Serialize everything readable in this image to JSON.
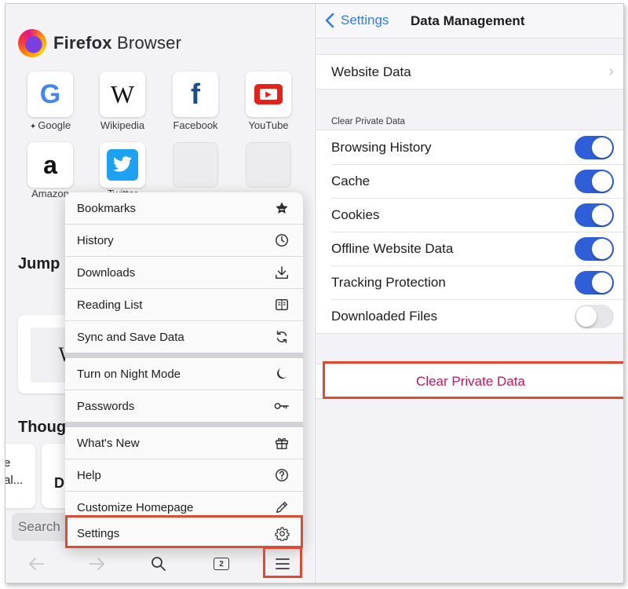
{
  "home": {
    "brand_bold": "Firefox",
    "brand_rest": " Browser",
    "top_sites": [
      {
        "label": "Google",
        "pinned": true,
        "glyph": "G",
        "color": "#4285F4"
      },
      {
        "label": "Wikipedia",
        "pinned": false,
        "glyph": "W",
        "color": "#111111"
      },
      {
        "label": "Facebook",
        "pinned": false,
        "glyph": "f",
        "color": "#1877F2"
      },
      {
        "label": "YouTube",
        "pinned": false,
        "glyph": "▶",
        "color": "#FF0000"
      },
      {
        "label": "Amazon",
        "pinned": false,
        "glyph": "a",
        "color": "#111111"
      },
      {
        "label": "Twitter",
        "pinned": false,
        "glyph": "🐦",
        "color": "#1DA1F2"
      }
    ],
    "jump_heading": "Jump",
    "thought_heading": "Thoug",
    "card_w": "W",
    "card_text_1": "e",
    "card_text_2": "al...",
    "card_d": "D",
    "search_placeholder": "Search",
    "tab_count": "2"
  },
  "menu": {
    "items": [
      {
        "label": "Bookmarks",
        "icon": "star-icon"
      },
      {
        "label": "History",
        "icon": "clock-icon"
      },
      {
        "label": "Downloads",
        "icon": "download-icon"
      },
      {
        "label": "Reading List",
        "icon": "reading-list-icon"
      },
      {
        "label": "Sync and Save Data",
        "icon": "sync-icon"
      },
      {
        "label": "Turn on Night Mode",
        "icon": "moon-icon"
      },
      {
        "label": "Passwords",
        "icon": "key-icon"
      },
      {
        "label": "What's New",
        "icon": "gift-icon"
      },
      {
        "label": "Help",
        "icon": "help-icon"
      },
      {
        "label": "Customize Homepage",
        "icon": "pencil-icon"
      },
      {
        "label": "Settings",
        "icon": "gear-icon"
      }
    ]
  },
  "settings": {
    "back_label": "Settings",
    "title": "Data Management",
    "website_data": "Website Data",
    "section_label": "Clear Private Data",
    "toggles": [
      {
        "label": "Browsing History",
        "on": true
      },
      {
        "label": "Cache",
        "on": true
      },
      {
        "label": "Cookies",
        "on": true
      },
      {
        "label": "Offline Website Data",
        "on": true
      },
      {
        "label": "Tracking Protection",
        "on": true
      },
      {
        "label": "Downloaded Files",
        "on": false
      }
    ],
    "clear_button": "Clear Private Data"
  },
  "colors": {
    "accent_blue": "#2f7cf6",
    "toggle_on": "#2f5fd8",
    "destructive": "#c2185b",
    "highlight": "#e14a32"
  }
}
